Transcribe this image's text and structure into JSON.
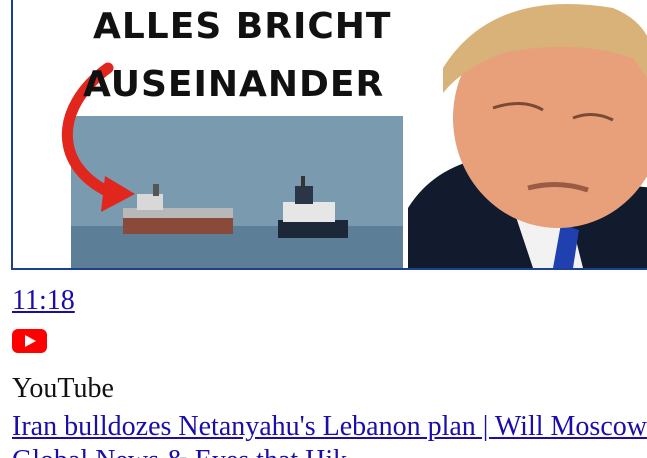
{
  "thumbnail": {
    "headline_line1": "ALLES BRICHT",
    "headline_line2": "AUSEINANDER",
    "accent_color": "#e0261d",
    "border_color": "#1c3f8f"
  },
  "video": {
    "duration": "11:18",
    "platform_icon": "youtube-icon",
    "source": "YouTube",
    "title": "Iran bulldozes Netanyahu's Lebanon plan | Will Moscow",
    "channel": "Global News & Eyes that Hik"
  }
}
